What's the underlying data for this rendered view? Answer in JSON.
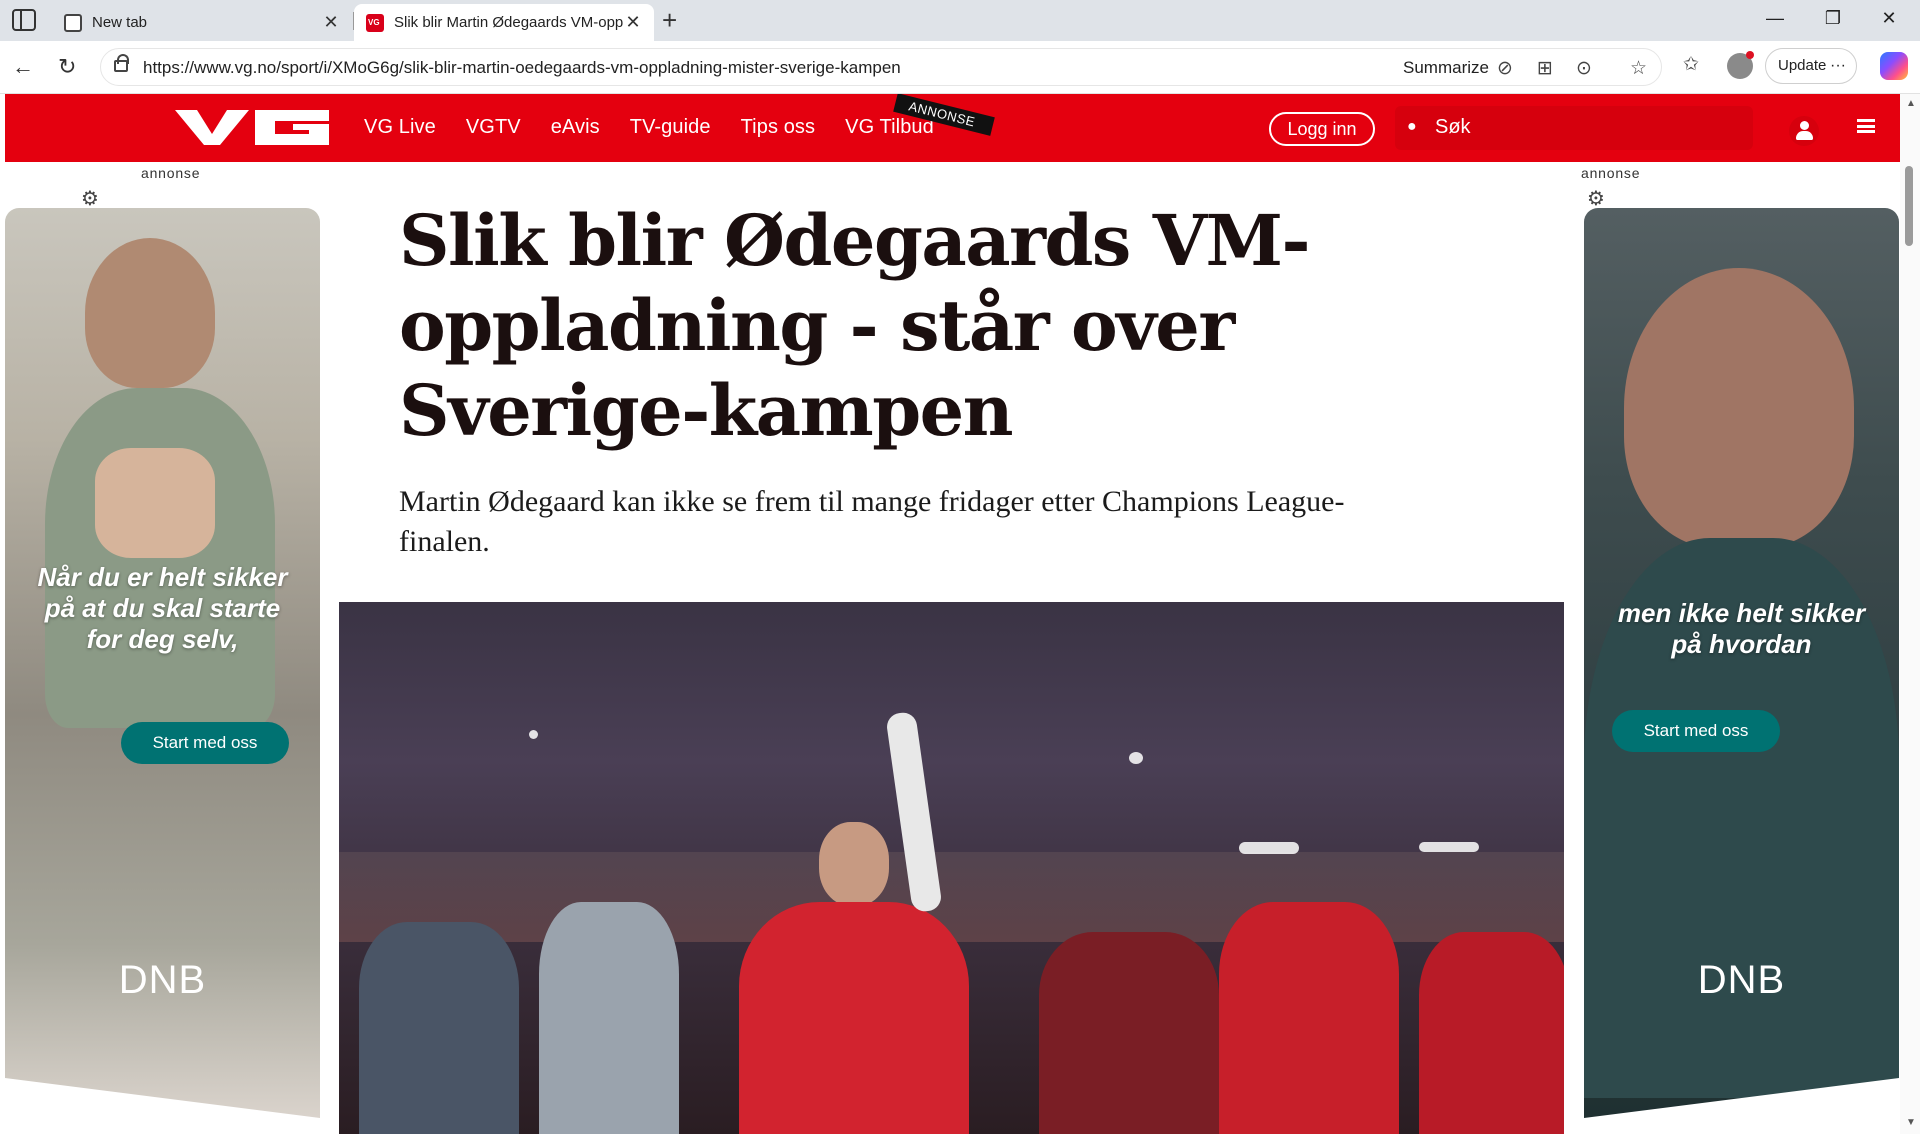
{
  "browser": {
    "tabs": [
      {
        "title": "New tab",
        "active": false
      },
      {
        "title": "Slik blir Martin Ødegaards VM-opp",
        "active": true
      }
    ],
    "url": "https://www.vg.no/sport/i/XMoG6g/slik-blir-martin-oedegaards-vm-oppladning-mister-sverige-kampen",
    "summarize_label": "Summarize",
    "update_label": "Update"
  },
  "site": {
    "nav": [
      "VG Live",
      "VGTV",
      "eAvis",
      "TV-guide",
      "Tips oss",
      "VG Tilbud"
    ],
    "annonse_tag": "ANNONSE",
    "login_label": "Logg inn",
    "search_placeholder": "Søk",
    "brand_color": "#e4000f"
  },
  "ads": {
    "label": "annonse",
    "left": {
      "text": "Når du er helt sikker på at du skal starte for deg selv,",
      "cta": "Start med oss",
      "logo": "DNB"
    },
    "right": {
      "text": "men ikke helt sikker på hvordan",
      "cta": "Start med oss",
      "logo": "DNB"
    },
    "cta_color": "#007272"
  },
  "article": {
    "headline": "Slik blir Ødegaards VM-oppladning - står over Sverige-kampen",
    "lead": "Martin Ødegaard kan ikke se frem til mange fridager etter Champions League-finalen."
  }
}
